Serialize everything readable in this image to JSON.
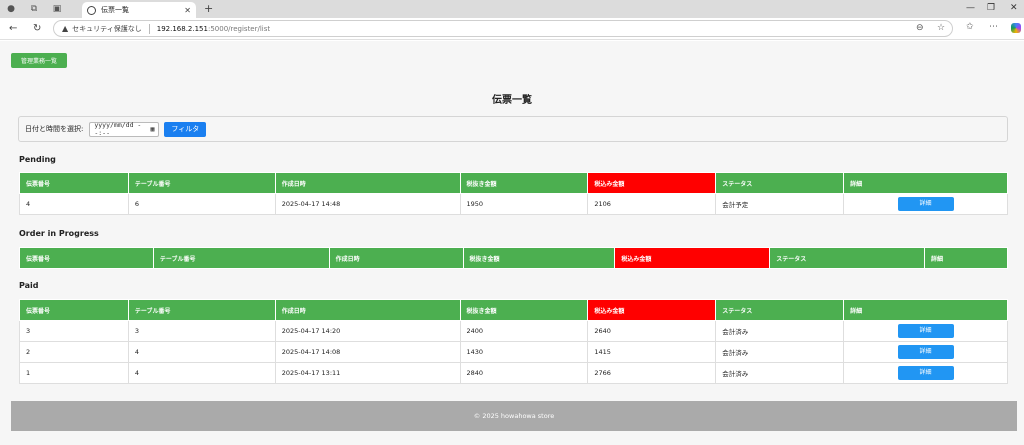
{
  "browser": {
    "tab_title": "伝票一覧",
    "security_label": "セキュリティ保護なし",
    "url_host": "192.168.2.151",
    "url_path": ":5000/register/list"
  },
  "header": {
    "management_button": "管理業務一覧"
  },
  "page_title": "伝票一覧",
  "filter": {
    "label": "日付と時間を選択:",
    "placeholder": "yyyy/mm/dd --:--",
    "button": "フィルタ"
  },
  "columns": [
    "伝票番号",
    "テーブル番号",
    "作成日時",
    "税抜き金額",
    "税込み金額",
    "ステータス",
    "詳細"
  ],
  "sections": [
    {
      "title": "Pending",
      "rows": [
        {
          "id": "4",
          "table": "6",
          "created": "2025-04-17 14:48",
          "pretax": "1950",
          "taxed": "2106",
          "status": "会計予定",
          "detail": "詳細"
        }
      ]
    },
    {
      "title": "Order in Progress",
      "rows": []
    },
    {
      "title": "Paid",
      "rows": [
        {
          "id": "3",
          "table": "3",
          "created": "2025-04-17 14:20",
          "pretax": "2400",
          "taxed": "2640",
          "status": "会計済み",
          "detail": "詳細"
        },
        {
          "id": "2",
          "table": "4",
          "created": "2025-04-17 14:08",
          "pretax": "1430",
          "taxed": "1415",
          "status": "会計済み",
          "detail": "詳細"
        },
        {
          "id": "1",
          "table": "4",
          "created": "2025-04-17 13:11",
          "pretax": "2840",
          "taxed": "2766",
          "status": "会計済み",
          "detail": "詳細"
        }
      ]
    }
  ],
  "footer": "© 2025 howahowa store",
  "colors": {
    "header_green": "#4caf50",
    "tax_red": "#ff0000",
    "detail_blue": "#2196f3",
    "filter_blue": "#1a7ff0",
    "footer_gray": "#aaaaaa"
  }
}
